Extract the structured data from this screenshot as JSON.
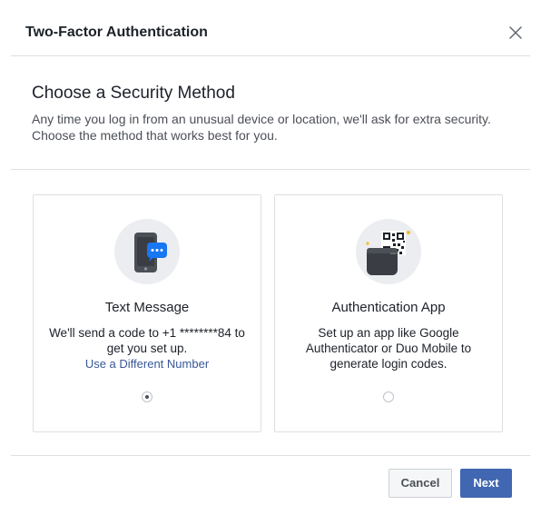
{
  "header": {
    "title": "Two-Factor Authentication",
    "close_icon": "close-icon"
  },
  "intro": {
    "title": "Choose a Security Method",
    "description": "Any time you log in from an unusual device or location, we'll ask for extra security. Choose the method that works best for you."
  },
  "methods": [
    {
      "icon": "phone-message-icon",
      "title": "Text Message",
      "description": "We'll send a code to +1 ********84 to get you set up.",
      "link": "Use a Different Number",
      "selected": true
    },
    {
      "icon": "qr-code-phone-icon",
      "title": "Authentication App",
      "description": "Set up an app like Google Authenticator or Duo Mobile to generate login codes.",
      "selected": false
    }
  ],
  "footer": {
    "cancel_label": "Cancel",
    "next_label": "Next"
  },
  "colors": {
    "primary": "#4267b2",
    "link": "#385898",
    "border": "#dddfe2",
    "icon_bg": "#ebedf0",
    "message_bubble": "#1877f2"
  }
}
